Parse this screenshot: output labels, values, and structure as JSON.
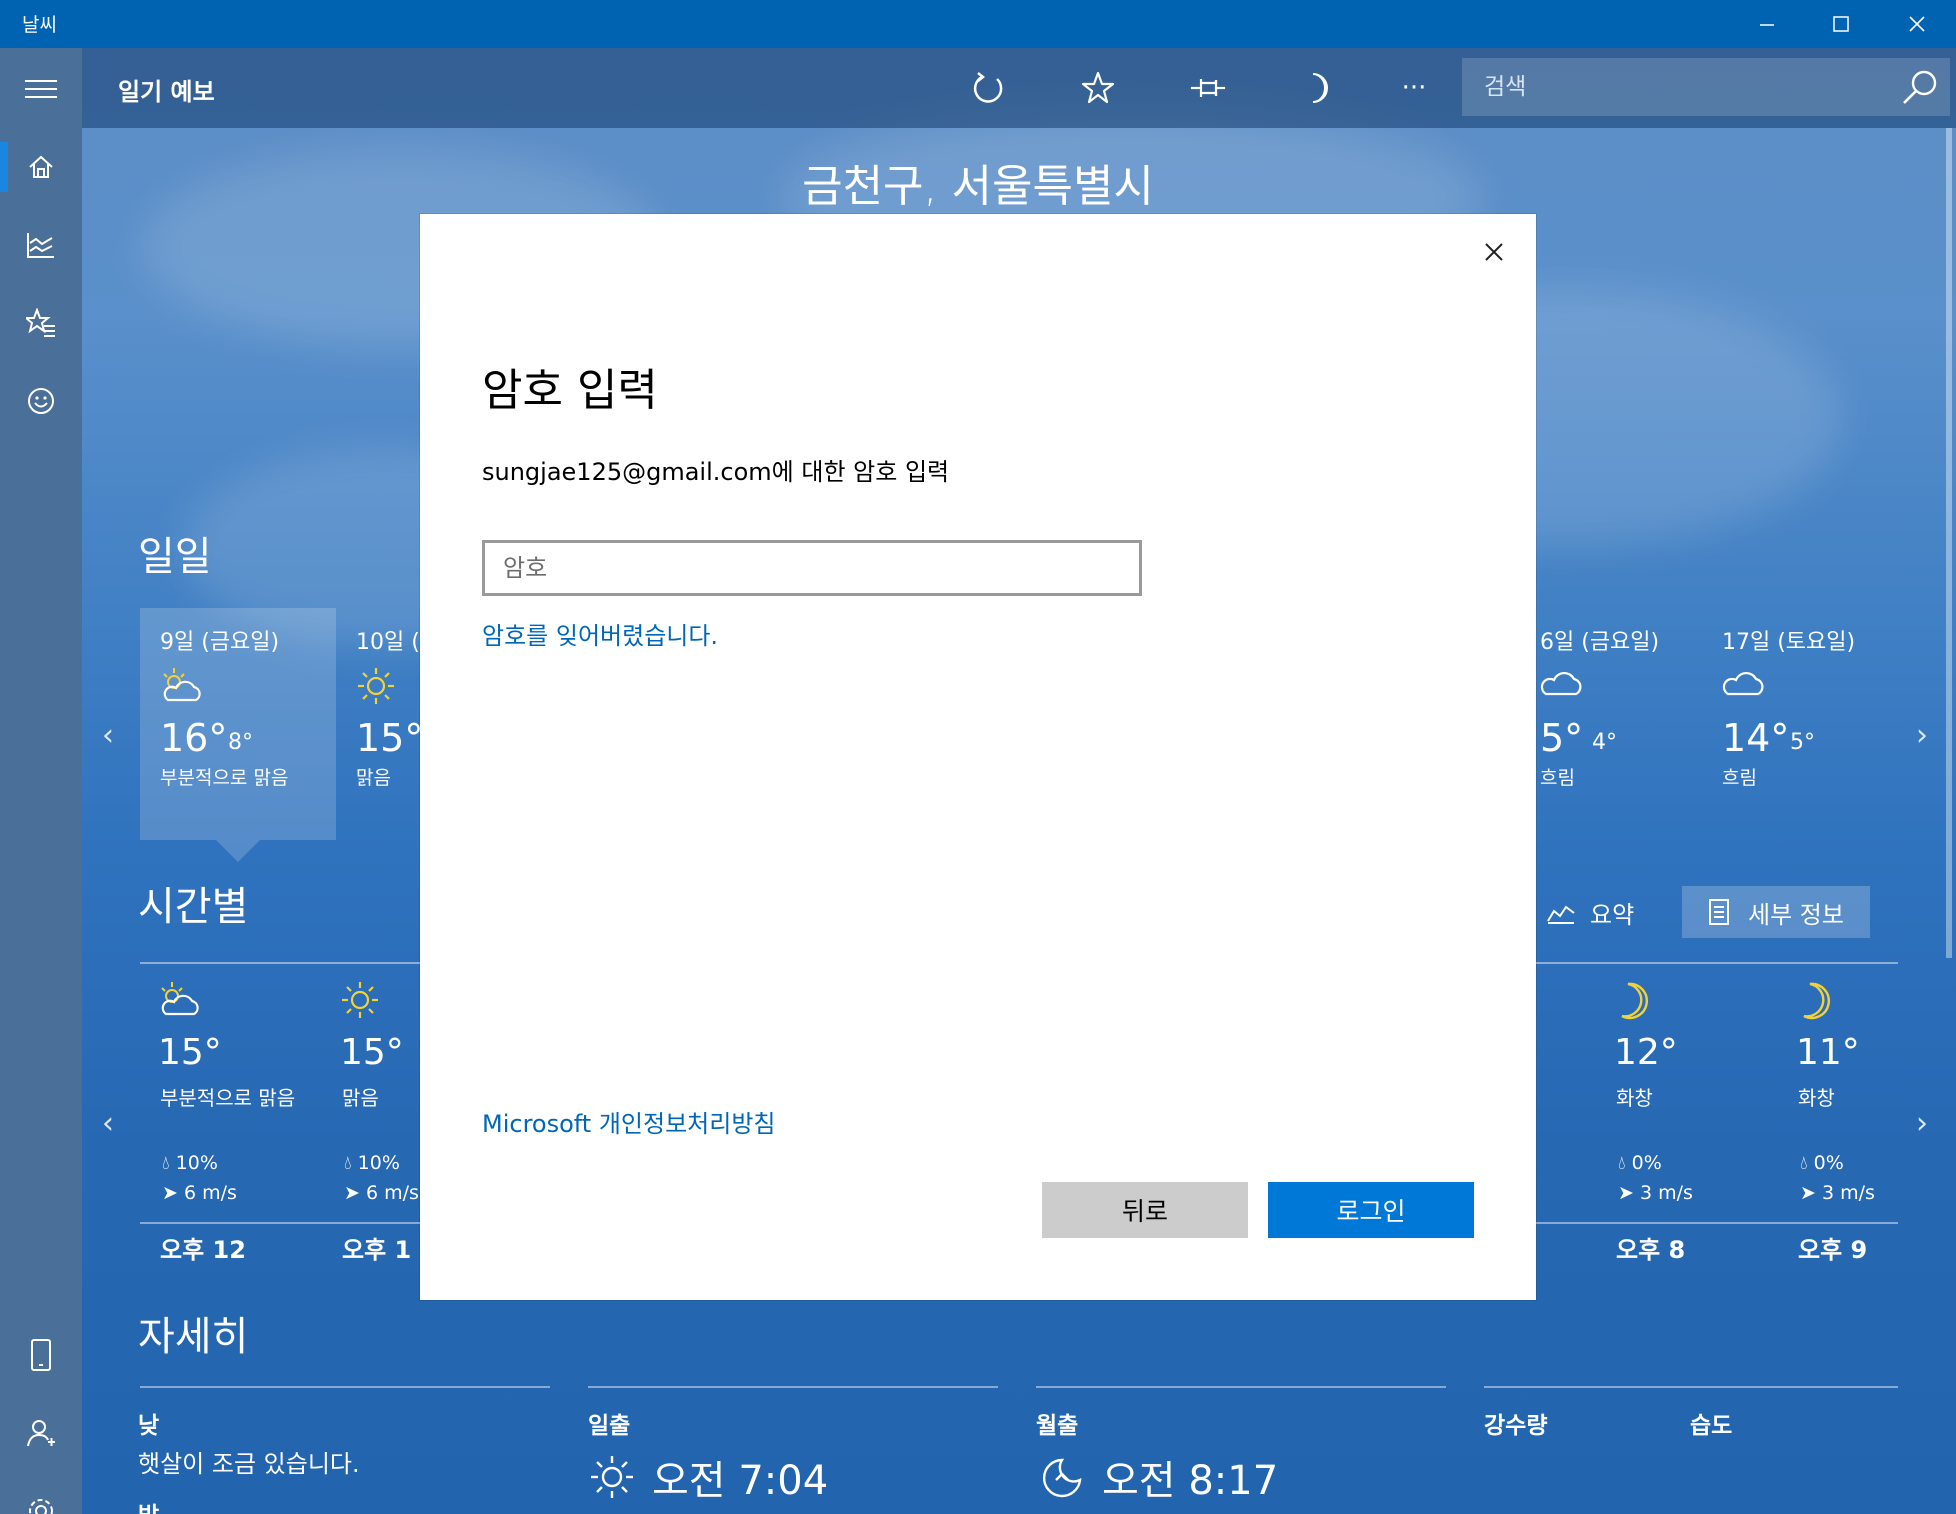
{
  "window": {
    "title": "날씨",
    "controls": [
      "minimize",
      "maximize",
      "close"
    ]
  },
  "header": {
    "title": "일기 예보",
    "tools": [
      "refresh-icon",
      "favorite-star-icon",
      "pin-icon",
      "moon-icon",
      "more-icon"
    ],
    "more_label": "···",
    "search_placeholder": "검색"
  },
  "nav_rail": {
    "items": [
      "menu-icon",
      "home-icon",
      "maps-chart-icon",
      "favorites-icon",
      "feedback-smile-icon"
    ],
    "bottom_items": [
      "phone-icon",
      "account-icon",
      "settings-gear-icon"
    ]
  },
  "location": "금천구, 서울특별시",
  "daily": {
    "title": "일일",
    "days": [
      {
        "date": "9일 (금요일)",
        "icon": "partly-sunny",
        "high": "16°",
        "low": "8°",
        "desc": "부분적으로 맑음",
        "selected": true
      },
      {
        "date": "10일 (",
        "icon": "sunny",
        "high": "15°",
        "low": "",
        "desc": "맑음"
      },
      {
        "date": "6일 (금요일)",
        "icon": "cloudy",
        "high": "5°",
        "low": "4°",
        "desc": "흐림"
      },
      {
        "date": "17일 (토요일)",
        "icon": "cloudy",
        "high": "14°",
        "low": "5°",
        "desc": "흐림"
      }
    ]
  },
  "hourly": {
    "title": "시간별",
    "summary_label": "요약",
    "details_label": "세부 정보",
    "hours": [
      {
        "icon": "partly-sunny",
        "temp": "15°",
        "cond": "부분적으로 맑음",
        "rain": "10%",
        "wind": "6 m/s",
        "time": "오후 12"
      },
      {
        "icon": "sunny",
        "temp": "15°",
        "cond": "맑음",
        "rain": "10%",
        "wind": "6 m/s",
        "time": "오후 1"
      },
      {
        "icon": "moon",
        "temp": "12°",
        "cond": "화창",
        "rain": "0%",
        "wind": "3 m/s",
        "time": "오후 8"
      },
      {
        "icon": "moon",
        "temp": "11°",
        "cond": "화창",
        "rain": "0%",
        "wind": "3 m/s",
        "time": "오후 9"
      }
    ]
  },
  "details": {
    "title": "자세히",
    "day_label": "낮",
    "day_text": "햇살이 조금 있습니다.",
    "night_label": "밤",
    "sunrise_label": "일출",
    "sunrise_time": "오전 7:04",
    "moonrise_label": "월출",
    "moonrise_time": "오전 8:17",
    "precip_label": "강수량",
    "humidity_label": "습도"
  },
  "dialog": {
    "title": "암호 입력",
    "subtitle": "sungjae125@gmail.com에 대한 암호 입력",
    "password_placeholder": "암호",
    "forgot_link": "암호를 잊어버렸습니다.",
    "privacy_link": "Microsoft 개인정보처리방침",
    "back_button": "뒤로",
    "login_button": "로그인"
  },
  "colors": {
    "titlebar": "#0063b1",
    "accent": "#0078d7",
    "link": "#0067b8",
    "sun_yellow": "#f3d238"
  }
}
